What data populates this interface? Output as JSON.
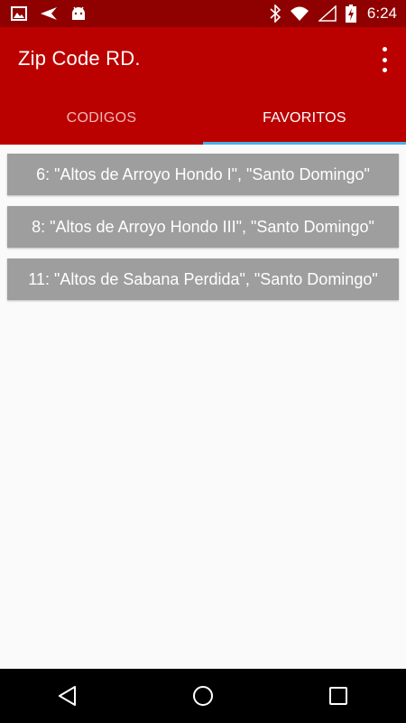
{
  "status_bar": {
    "time": "6:24",
    "left_icons": [
      "image-icon",
      "send-icon",
      "android-icon"
    ],
    "right_icons": [
      "bluetooth-icon",
      "wifi-icon",
      "cell-signal-icon",
      "battery-charging-icon"
    ]
  },
  "app_bar": {
    "title": "Zip Code RD.",
    "menu_icon": "more-vert-icon"
  },
  "tabs": [
    {
      "label": "CODIGOS",
      "active": false
    },
    {
      "label": "FAVORITOS",
      "active": true
    }
  ],
  "favorites": [
    {
      "label": "6: \"Altos de Arroyo Hondo I\", \"Santo Domingo\""
    },
    {
      "label": "8: \"Altos de Arroyo Hondo III\", \"Santo Domingo\""
    },
    {
      "label": "11: \"Altos de Sabana Perdida\", \"Santo Domingo\""
    }
  ],
  "nav_bar": {
    "buttons": [
      "back-icon",
      "home-icon",
      "recents-icon"
    ]
  },
  "colors": {
    "status_bar": "#8f0000",
    "app_bar": "#bb0000",
    "tab_indicator": "#4aaee8",
    "list_item": "#9e9e9e",
    "background": "#fafafa"
  }
}
